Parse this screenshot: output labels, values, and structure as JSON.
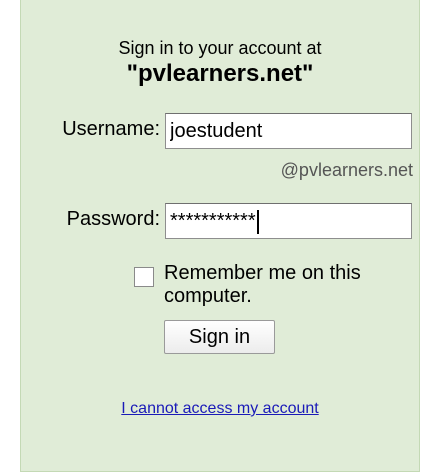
{
  "login": {
    "heading_line1": "Sign in to your account at",
    "heading_line2": "\"pvlearners.net\"",
    "username_label": "Username:",
    "username_value": "joestudent",
    "domain_hint": "@pvlearners.net",
    "password_label": "Password:",
    "password_mask": "***********",
    "remember_label": "Remember me on this computer.",
    "remember_checked": false,
    "signin_label": "Sign in",
    "help_link": "I cannot access my account"
  },
  "colors": {
    "panel_background": "#e0ecd7",
    "link": "#1a1ab8"
  }
}
